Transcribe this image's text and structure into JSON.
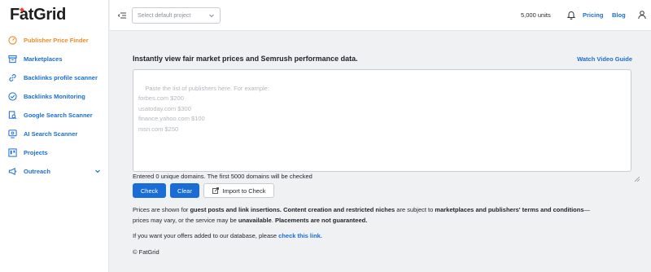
{
  "brand": {
    "logo_text": "FatGrid"
  },
  "sidebar": {
    "items": [
      {
        "label": "Publisher Price Finder",
        "icon": "gauge-icon"
      },
      {
        "label": "Marketplaces",
        "icon": "archive-icon"
      },
      {
        "label": "Backlinks profile scanner",
        "icon": "link-icon"
      },
      {
        "label": "Backlinks Monitoring",
        "icon": "check-circle-icon"
      },
      {
        "label": "Google Search Scanner",
        "icon": "search-doc-icon"
      },
      {
        "label": "AI Search Scanner",
        "icon": "ai-scan-icon"
      },
      {
        "label": "Projects",
        "icon": "board-icon"
      },
      {
        "label": "Outreach",
        "icon": "megaphone-icon"
      }
    ]
  },
  "topbar": {
    "project_select_placeholder": "Select default project",
    "units": "5,000 units",
    "pricing_label": "Pricing",
    "blog_label": "Blog"
  },
  "main": {
    "heading": "Instantly view fair market prices and Semrush performance data.",
    "video_link": "Watch Video Guide",
    "textarea_placeholder": "Paste the list of publishers here. For example:\nforbes.com $200\nusatoday.com $300\nfinance.yahoo.com $100\nmsn.com $250",
    "entered_text": "Entered 0 unique domains. The first 5000 domains will be checked",
    "check_label": "Check",
    "clear_label": "Clear",
    "import_label": "Import to Check",
    "notice": {
      "p1": "Prices are shown for ",
      "b1": "guest posts and link insertions.",
      "p2": " ",
      "b2": "Content creation and restricted niches",
      "p3": " are subject to ",
      "b3": "marketplaces and publishers' terms and conditions",
      "p4": "—",
      "p5": "prices may vary, or the service may be ",
      "b4": "unavailable",
      "p6": ". ",
      "b5": "Placements are not guaranteed."
    },
    "offers_text": "If you want your offers added to our database, please ",
    "offers_link": "check this link.",
    "copyright": "© FatGrid"
  },
  "colors": {
    "accent": "#1a6dd6",
    "active": "#f28c28",
    "brand_red": "#e8452c"
  }
}
